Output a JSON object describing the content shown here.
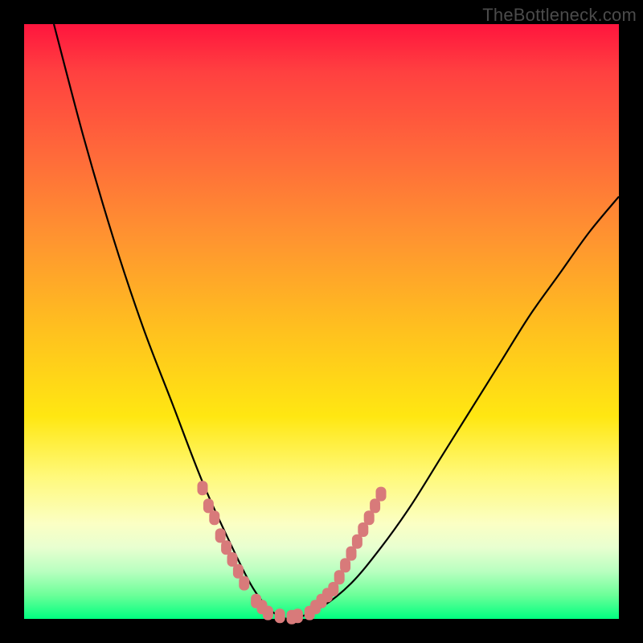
{
  "watermark": {
    "text": "TheBottleneck.com"
  },
  "colors": {
    "frame": "#000000",
    "curve": "#000000",
    "marker": "#d87a7a",
    "gradient_top": "#ff153e",
    "gradient_bottom": "#00ff80"
  },
  "chart_data": {
    "type": "line",
    "title": "",
    "xlabel": "",
    "ylabel": "",
    "xlim": [
      0,
      100
    ],
    "ylim": [
      0,
      100
    ],
    "grid": false,
    "legend": false,
    "series": [
      {
        "name": "bottleneck-curve",
        "color": "#000000",
        "x": [
          5,
          10,
          15,
          20,
          25,
          30,
          35,
          38,
          40,
          42,
          45,
          50,
          55,
          60,
          65,
          70,
          75,
          80,
          85,
          90,
          95,
          100
        ],
        "values": [
          100,
          81,
          64,
          49,
          36,
          23,
          12,
          6,
          3,
          1,
          0,
          2,
          6,
          12,
          19,
          27,
          35,
          43,
          51,
          58,
          65,
          71
        ]
      }
    ],
    "markers": [
      {
        "name": "left-cluster",
        "color": "#d87a7a",
        "points": [
          {
            "x": 30,
            "y": 22
          },
          {
            "x": 31,
            "y": 19
          },
          {
            "x": 32,
            "y": 17
          },
          {
            "x": 33,
            "y": 14
          },
          {
            "x": 34,
            "y": 12
          },
          {
            "x": 35,
            "y": 10
          },
          {
            "x": 36,
            "y": 8
          },
          {
            "x": 37,
            "y": 6
          },
          {
            "x": 39,
            "y": 3
          },
          {
            "x": 40,
            "y": 2
          },
          {
            "x": 41,
            "y": 1
          },
          {
            "x": 43,
            "y": 0.5
          },
          {
            "x": 45,
            "y": 0.3
          },
          {
            "x": 46,
            "y": 0.5
          }
        ]
      },
      {
        "name": "right-cluster",
        "color": "#d87a7a",
        "points": [
          {
            "x": 48,
            "y": 1
          },
          {
            "x": 49,
            "y": 2
          },
          {
            "x": 50,
            "y": 3
          },
          {
            "x": 51,
            "y": 4
          },
          {
            "x": 52,
            "y": 5
          },
          {
            "x": 53,
            "y": 7
          },
          {
            "x": 54,
            "y": 9
          },
          {
            "x": 55,
            "y": 11
          },
          {
            "x": 56,
            "y": 13
          },
          {
            "x": 57,
            "y": 15
          },
          {
            "x": 58,
            "y": 17
          },
          {
            "x": 59,
            "y": 19
          },
          {
            "x": 60,
            "y": 21
          }
        ]
      }
    ]
  }
}
